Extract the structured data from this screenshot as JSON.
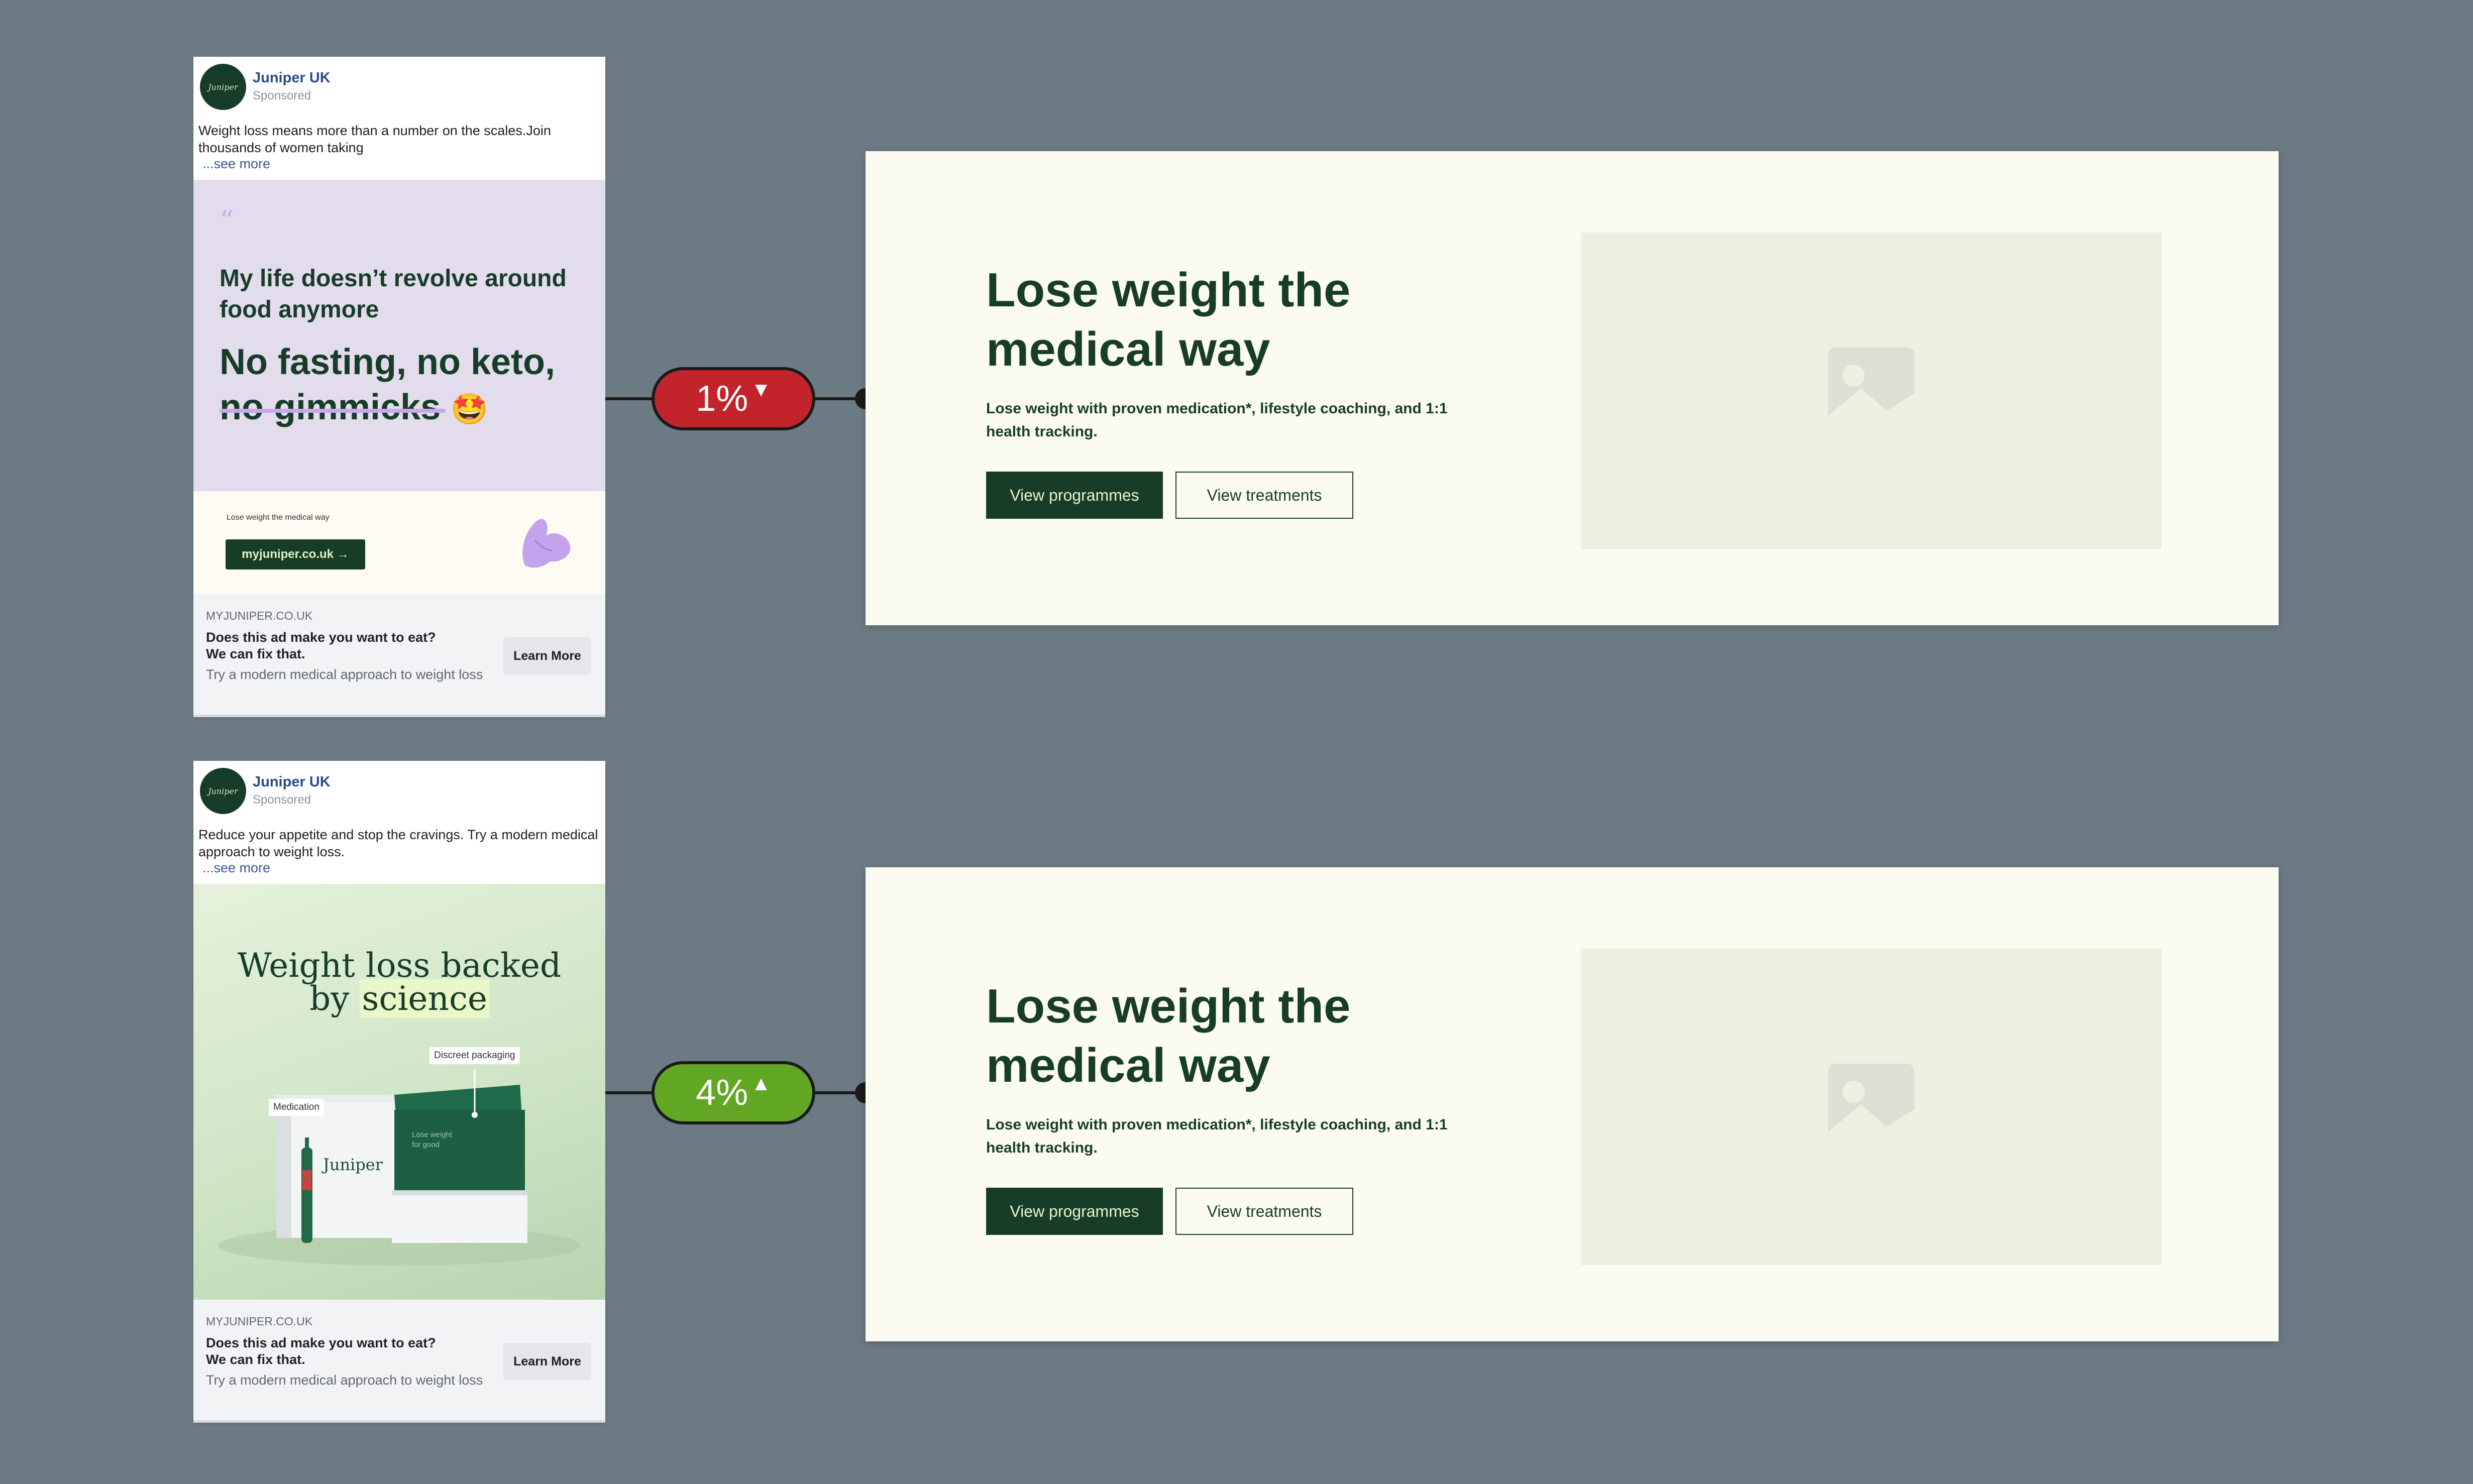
{
  "colors": {
    "background": "#6c7a83",
    "brand_green": "#173d29",
    "decrease": "#c3232a",
    "increase": "#62a724"
  },
  "ads": [
    {
      "page_name": "Juniper UK",
      "avatar_text": "Juniper",
      "sponsored": "Sponsored",
      "primary_text": "Weight loss means more than a number on the scales.Join thousands of women taking",
      "see_more": "...see more",
      "creative": {
        "quote_mark": "“",
        "quote": "My life doesn’t revolve around food anymore",
        "headline": "No fasting, no keto, no gimmicks",
        "emoji": "🤩",
        "footer_tagline": "Lose weight the medical way",
        "footer_button": "myjuniper.co.uk →"
      },
      "link": {
        "domain": "MYJUNIPER.CO.UK",
        "title": "Does this ad make you want to eat?\nWe can fix that.",
        "description": "Try a modern medical approach to weight loss",
        "cta": "Learn More"
      }
    },
    {
      "page_name": "Juniper UK",
      "avatar_text": "Juniper",
      "sponsored": "Sponsored",
      "primary_text": "Reduce your appetite and stop the cravings. Try a modern medical approach to weight loss.",
      "see_more": "...see more",
      "creative": {
        "headline_line1": "Weight loss backed",
        "headline_by": "by ",
        "headline_highlight": "science",
        "tag_packaging": "Discreet packaging",
        "tag_medication": "Medication",
        "box_brand": "Juniper",
        "box_inner_text": "Lose weight for good"
      },
      "link": {
        "domain": "MYJUNIPER.CO.UK",
        "title": "Does this ad make you want to eat?\nWe can fix that.",
        "description": "Try a modern medical approach to weight loss",
        "cta": "Learn More"
      }
    }
  ],
  "results": [
    {
      "value": "1%",
      "direction": "down",
      "arrow": "▼"
    },
    {
      "value": "4%",
      "direction": "up",
      "arrow": "▲"
    }
  ],
  "landing_pages": [
    {
      "title": "Lose weight the medical way",
      "subtitle": "Lose weight with proven medication*, lifestyle coaching, and 1:1 health tracking.",
      "primary_button": "View programmes",
      "secondary_button": "View treatments",
      "image_icon": "image-placeholder-icon"
    },
    {
      "title": "Lose weight the medical way",
      "subtitle": "Lose weight with proven medication*, lifestyle coaching, and 1:1 health tracking.",
      "primary_button": "View programmes",
      "secondary_button": "View treatments",
      "image_icon": "image-placeholder-icon"
    }
  ]
}
